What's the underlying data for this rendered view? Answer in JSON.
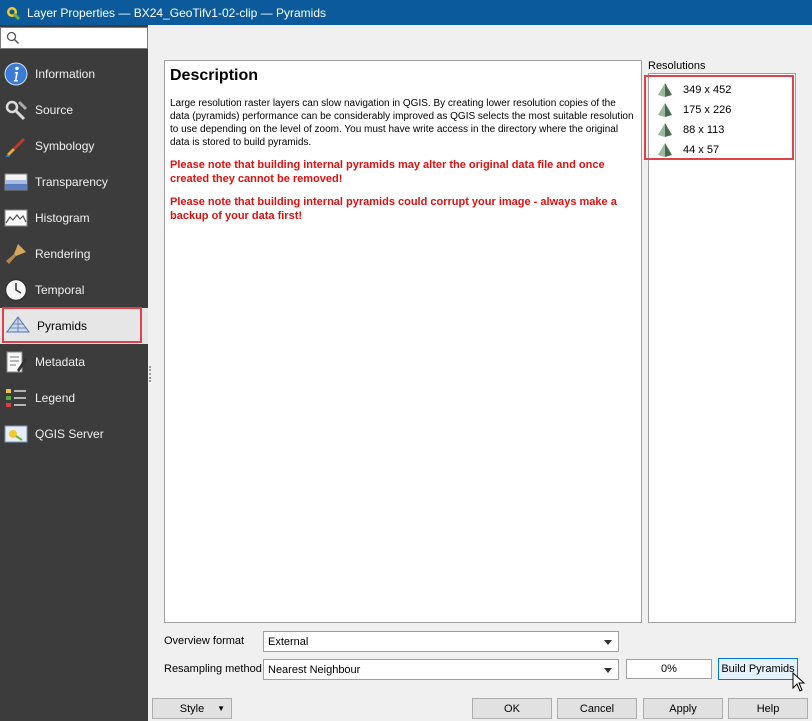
{
  "window": {
    "title": "Layer Properties — BX24_GeoTifv1-02-clip — Pyramids"
  },
  "sidebar": {
    "search_placeholder": "",
    "items": [
      {
        "label": "Information",
        "icon": "information-icon"
      },
      {
        "label": "Source",
        "icon": "source-wrench-icon"
      },
      {
        "label": "Symbology",
        "icon": "symbology-paintbrush-icon"
      },
      {
        "label": "Transparency",
        "icon": "transparency-icon"
      },
      {
        "label": "Histogram",
        "icon": "histogram-icon"
      },
      {
        "label": "Rendering",
        "icon": "rendering-brush-icon"
      },
      {
        "label": "Temporal",
        "icon": "temporal-clock-icon"
      },
      {
        "label": "Pyramids",
        "icon": "pyramids-icon",
        "selected": true
      },
      {
        "label": "Metadata",
        "icon": "metadata-icon"
      },
      {
        "label": "Legend",
        "icon": "legend-icon"
      },
      {
        "label": "QGIS Server",
        "icon": "qgis-server-icon"
      }
    ]
  },
  "description": {
    "heading": "Description",
    "body": "Large resolution raster layers can slow navigation in QGIS. By creating lower resolution copies of the data (pyramids) performance can be considerably improved as QGIS selects the most suitable resolution to use depending on the level of zoom. You must have write access in the directory where the original data is stored to build pyramids.",
    "warning1": "Please note that building internal pyramids may alter the original data file and once created they cannot be removed!",
    "warning2": "Please note that building internal pyramids could corrupt your image - always make a backup of your data first!"
  },
  "resolutions": {
    "label": "Resolutions",
    "items": [
      "349 x 452",
      "175 x 226",
      "88 x 113",
      "44 x 57"
    ]
  },
  "form": {
    "overview_format_label": "Overview format",
    "overview_format_value": "External",
    "resampling_label": "Resampling method",
    "resampling_value": "Nearest Neighbour",
    "progress_text": "0%",
    "build_button": "Build Pyramids"
  },
  "footer": {
    "style_button": "Style",
    "ok_button": "OK",
    "cancel_button": "Cancel",
    "apply_button": "Apply",
    "help_button": "Help"
  },
  "colors": {
    "titlebar": "#0a5a9c",
    "sidebar": "#3c3c3c",
    "warning_text": "#e01010",
    "highlight_box": "#e0424b"
  }
}
